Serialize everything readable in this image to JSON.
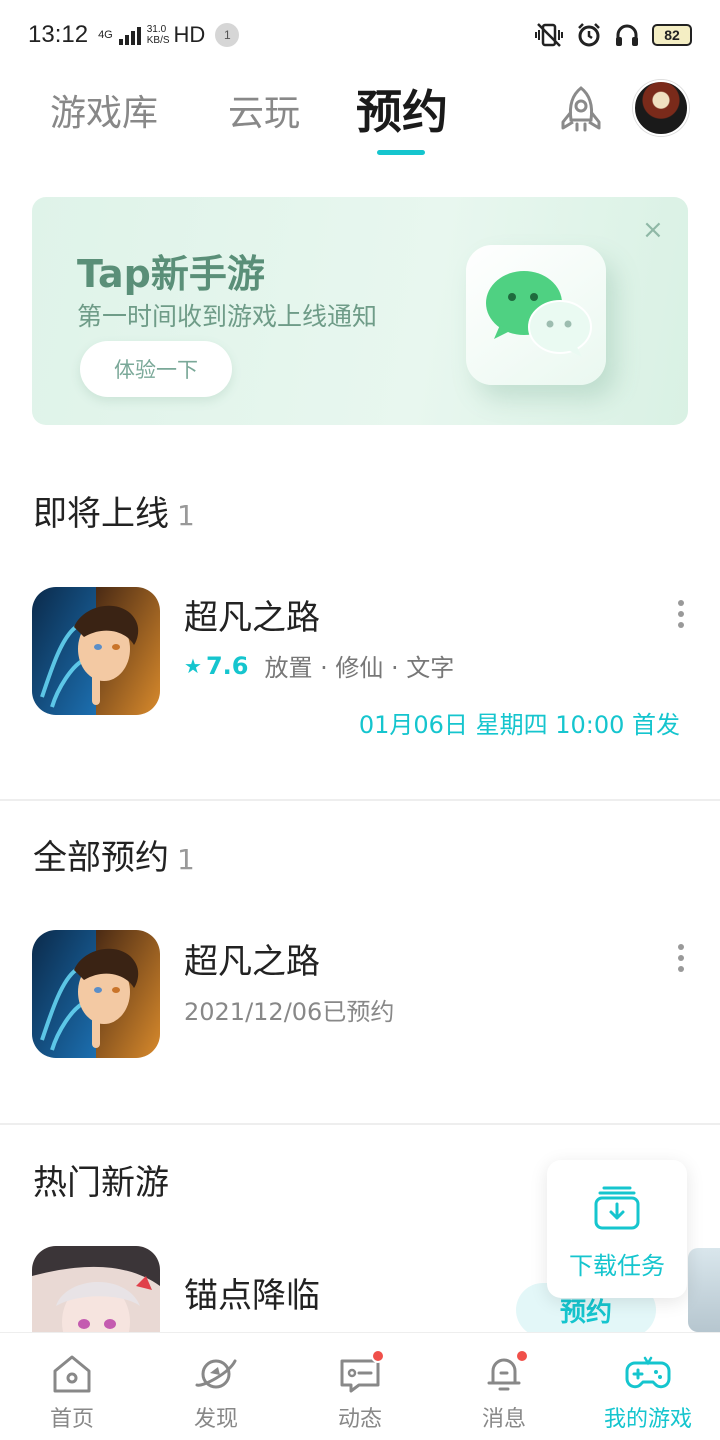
{
  "status_bar": {
    "time": "13:12",
    "network": "4G",
    "speed_top": "31.0",
    "speed_unit": "KB/S",
    "hd": "HD",
    "notification_count": "1",
    "battery": "82"
  },
  "top_tabs": {
    "tabs": [
      {
        "label": "游戏库",
        "active": false
      },
      {
        "label": "云玩",
        "active": false
      },
      {
        "label": "预约",
        "active": true
      }
    ],
    "accent": "#15c5ce"
  },
  "banner": {
    "title": "Tap新手游",
    "subtitle": "第一时间收到游戏上线通知",
    "button_label": "体验一下",
    "close": "×"
  },
  "upcoming": {
    "title": "即将上线",
    "count": "1",
    "games": [
      {
        "name": "超凡之路",
        "rating": "7.6",
        "tags": "放置 · 修仙 · 文字",
        "release": "01月06日 星期四 10:00 首发"
      }
    ]
  },
  "all_reserved": {
    "title": "全部预约",
    "count": "1",
    "games": [
      {
        "name": "超凡之路",
        "reserved_date": "2021/12/06已预约"
      }
    ]
  },
  "hot_new": {
    "title": "热门新游",
    "games": [
      {
        "name": "锚点降临",
        "button_label": "预约"
      }
    ]
  },
  "download_task": {
    "label": "下载任务"
  },
  "bottom_nav": {
    "items": [
      {
        "label": "首页",
        "icon": "home-icon",
        "active": false
      },
      {
        "label": "发现",
        "icon": "planet-icon",
        "active": false
      },
      {
        "label": "动态",
        "icon": "message-card-icon",
        "active": false
      },
      {
        "label": "消息",
        "icon": "bell-icon",
        "active": false
      },
      {
        "label": "我的游戏",
        "icon": "gamepad-icon",
        "active": true
      }
    ]
  }
}
